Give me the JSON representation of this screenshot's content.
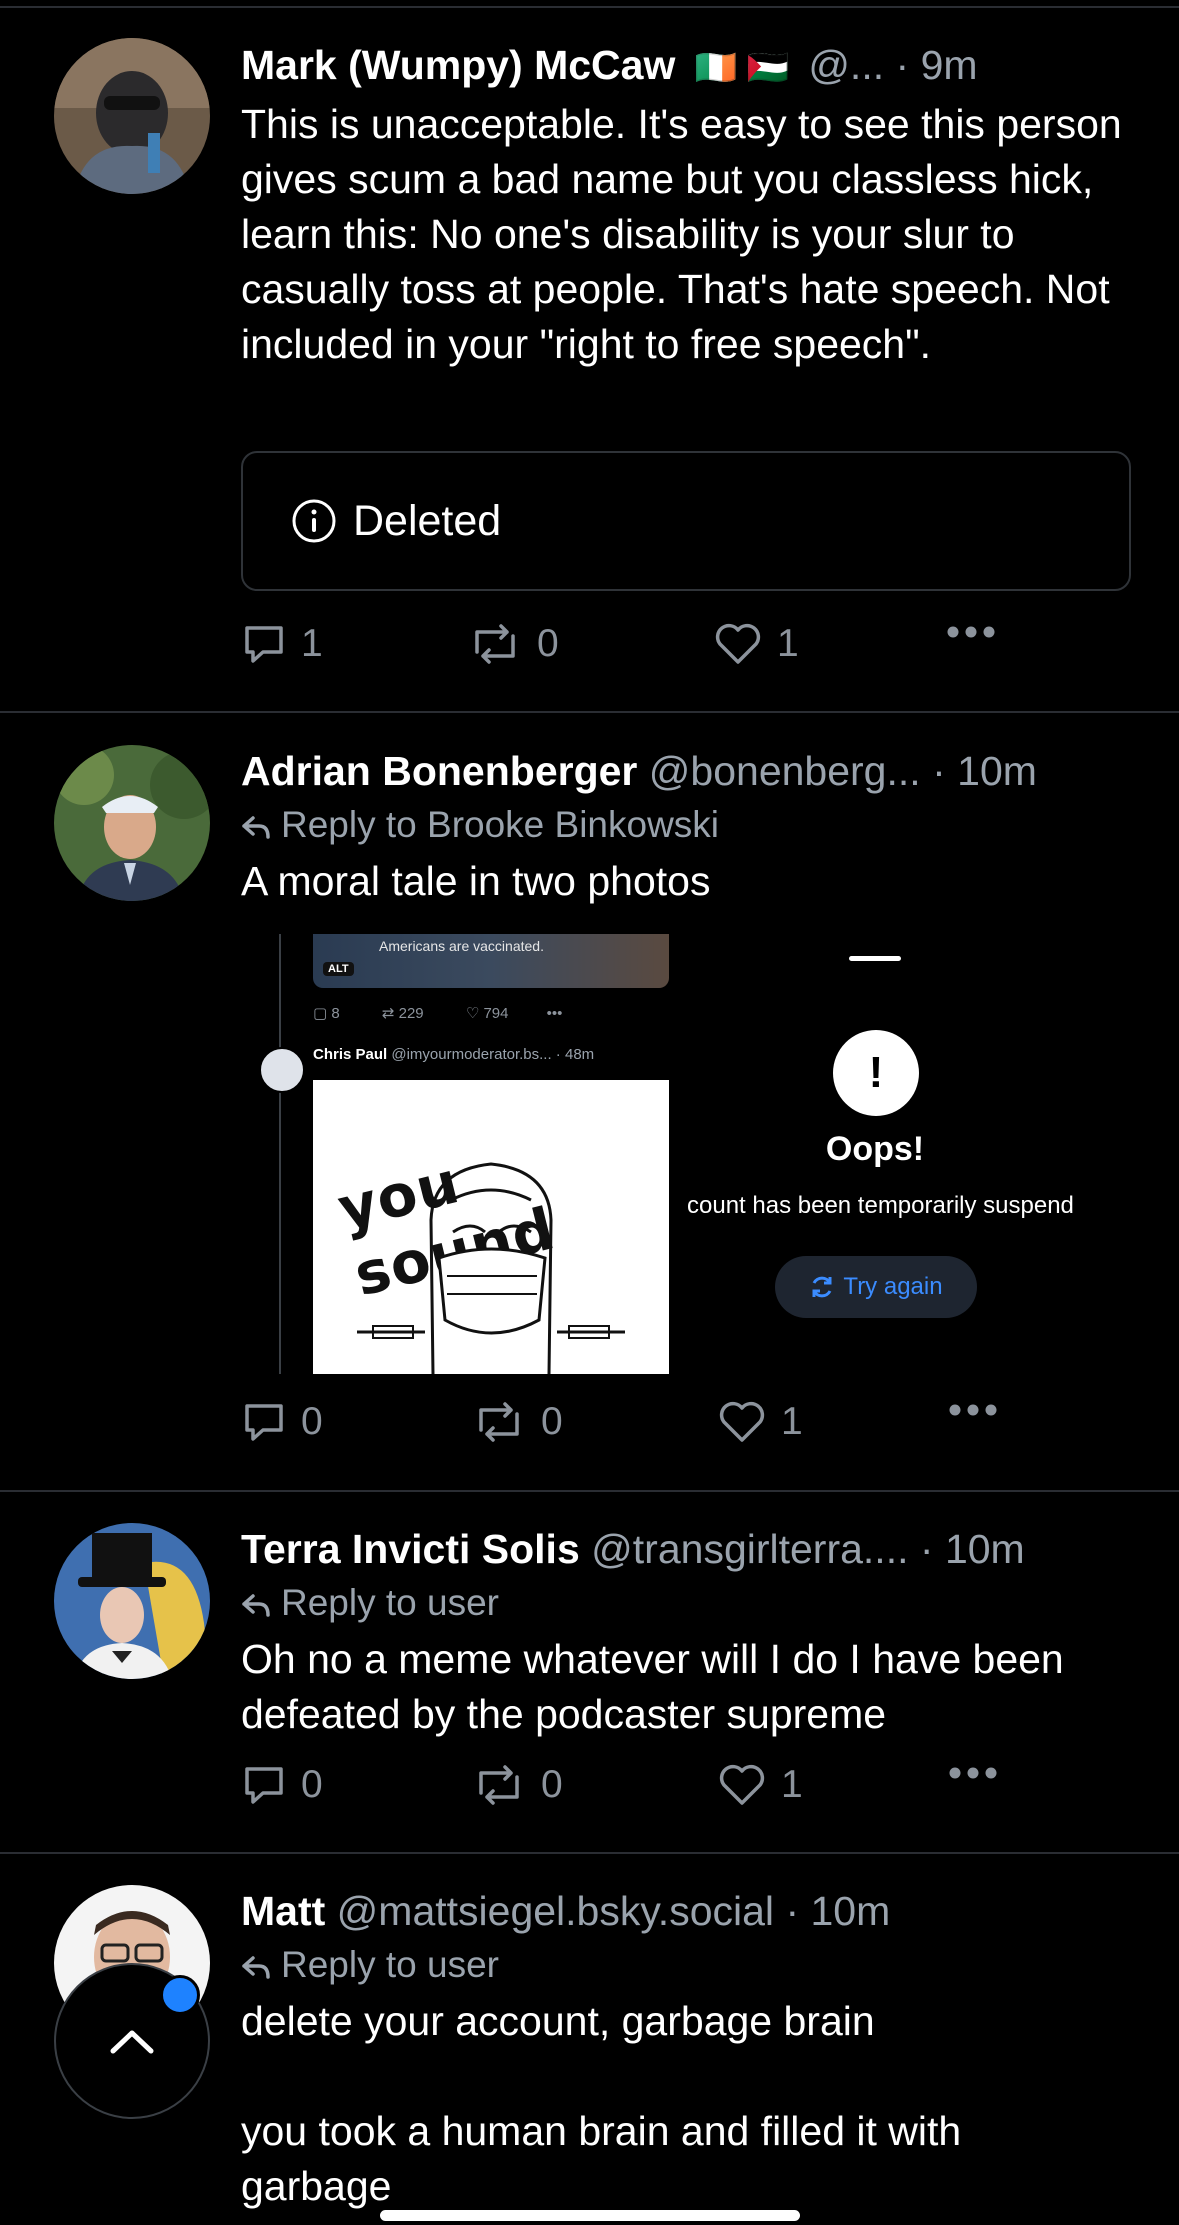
{
  "posts": [
    {
      "author": "Mark (Wumpy) McCaw",
      "flags": "🇮🇪 🇵🇸",
      "handle": "@...",
      "sep": "·",
      "time": "9m",
      "text": "This is unacceptable. It's easy to see this person gives scum a bad name but you classless hick, learn this: No one's disability is your slur to casually toss at people. That's hate speech. Not included in your \"right to free speech\".",
      "deleted_label": "Deleted",
      "replies": "1",
      "reposts": "0",
      "likes": "1"
    },
    {
      "author": "Adrian Bonenberger",
      "handle": "@bonenberg...",
      "sep": "·",
      "time": "10m",
      "reply_to": "Reply to Brooke Binkowski",
      "text": "A moral tale in two photos",
      "replies": "0",
      "reposts": "0",
      "likes": "1",
      "embed": {
        "left_caption": "Americans are vaccinated.",
        "alt_badge": "ALT",
        "mini_replies": "8",
        "mini_reposts": "229",
        "mini_likes": "794",
        "quoted_author": "Chris Paul",
        "quoted_handle": "@imyourmoderator.bs... · 48m",
        "meme_text": "you sound",
        "oops_title": "Oops!",
        "oops_body": "count has been temporarily suspend",
        "try_again": "Try again",
        "bang": "!"
      }
    },
    {
      "author": "Terra Invicti Solis",
      "handle": "@transgirlterra....",
      "sep": "·",
      "time": "10m",
      "reply_to": "Reply to user",
      "text": "Oh no a meme whatever will I do I have been defeated by the podcaster supreme",
      "replies": "0",
      "reposts": "0",
      "likes": "1"
    },
    {
      "author": "Matt",
      "handle": "@mattsiegel.bsky.social",
      "sep": "·",
      "time": "10m",
      "reply_to": "Reply to user",
      "text_line1": "delete your account, garbage brain",
      "text_line2": "you took a human brain and filled it with garbage"
    }
  ],
  "colors": {
    "background": "#000000",
    "muted": "#9aa3ad",
    "accent": "#1e82ff",
    "divider": "#2a2d33"
  },
  "icons": [
    "reply-icon",
    "repost-icon",
    "like-icon",
    "more-icon",
    "info-icon",
    "reply-arrow-icon",
    "scroll-top-icon"
  ]
}
